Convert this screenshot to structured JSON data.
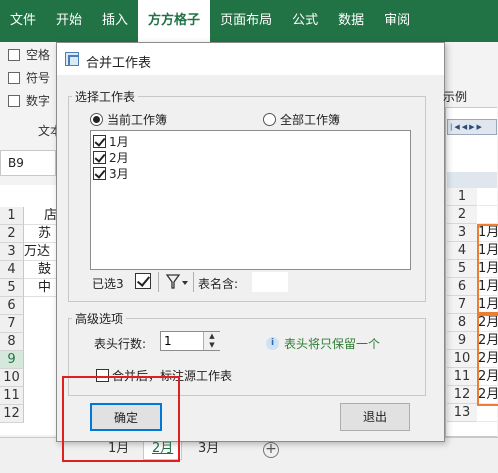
{
  "ribbon": {
    "tabs": [
      "文件",
      "开始",
      "插入",
      "方方格子",
      "页面布局",
      "公式",
      "数据",
      "审阅"
    ],
    "active_tab_index": 3,
    "checkbox_items": [
      "空格",
      "符号",
      "数字"
    ],
    "group_label": "文本"
  },
  "formula_bar": {
    "name_box": "B9"
  },
  "sheet": {
    "row_numbers": [
      "1",
      "2",
      "3",
      "4",
      "5",
      "6",
      "7",
      "8",
      "9",
      "10",
      "11",
      "12"
    ],
    "selected_row_index": 8,
    "column_b_values": [
      "店",
      "苏",
      "万达",
      "鼓",
      "中",
      "",
      "",
      "",
      "",
      "",
      "",
      ""
    ]
  },
  "sheet_tabs": {
    "tabs": [
      "1月",
      "2月",
      "3月"
    ],
    "active_index": 1,
    "add_symbol": "+"
  },
  "dialog": {
    "title": "合并工作表",
    "select_sheets_group": "选择工作表",
    "radio_current": "当前工作簿",
    "radio_all": "全部工作簿",
    "sheets": [
      {
        "name": "1月",
        "checked": true
      },
      {
        "name": "2月",
        "checked": true
      },
      {
        "name": "3月",
        "checked": true
      }
    ],
    "selected_count_label": "已选3",
    "name_contains_label": "表名含:",
    "name_contains_value": "",
    "advanced_group": "高级选项",
    "header_rows_label": "表头行数:",
    "header_rows_value": "1",
    "header_hint": "表头将只保留一个",
    "mark_source_label": "合并后，标注源工作表",
    "mark_source_checked": false,
    "ok_label": "确定",
    "cancel_label": "退出",
    "preview_label": "示例"
  },
  "preview": {
    "row_numbers": [
      "1",
      "2",
      "3",
      "4",
      "5",
      "6",
      "7",
      "8",
      "9",
      "10",
      "11",
      "12",
      "13"
    ],
    "values": [
      "",
      "",
      "1月",
      "1月",
      "1月",
      "1月",
      "1月",
      "2月",
      "2月",
      "2月",
      "2月",
      "2月",
      ""
    ],
    "highlight_color": "#ed7d31"
  },
  "colors": {
    "ribbon_green": "#217346",
    "annotation_red": "#e02020",
    "hint_green": "#2e7d32"
  }
}
